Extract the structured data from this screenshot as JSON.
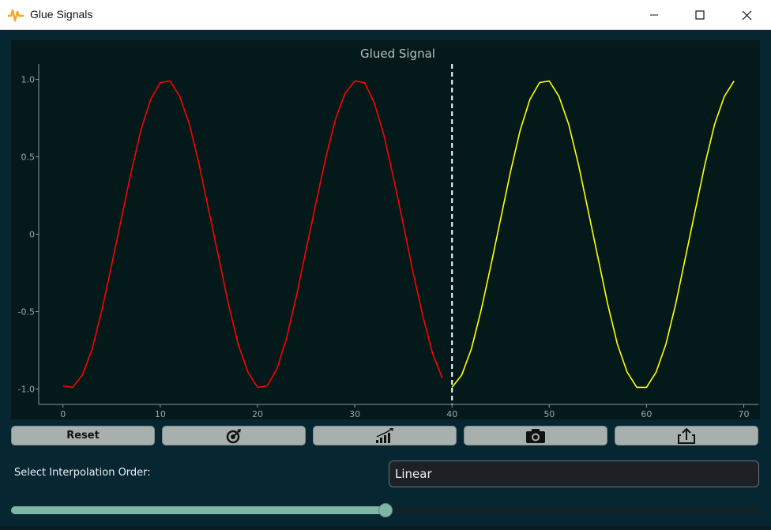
{
  "window": {
    "title": "Glue Signals"
  },
  "toolbar": {
    "reset_label": "Reset",
    "icons": [
      "target-icon",
      "chart-growth-icon",
      "camera-icon",
      "share-icon"
    ]
  },
  "interpolation": {
    "label": "Select Interpolation Order:",
    "selected": "Linear"
  },
  "slider": {
    "value_fraction": 0.5
  },
  "chart_data": {
    "type": "line",
    "title": "Glued Signal",
    "xlabel": "",
    "ylabel": "",
    "xlim": [
      -2.5,
      71.5
    ],
    "ylim": [
      -1.1,
      1.1
    ],
    "xticks": [
      0,
      10,
      20,
      30,
      40,
      50,
      60,
      70
    ],
    "yticks": [
      1.0,
      0.5,
      0,
      -0.5,
      -1.0
    ],
    "ytick_labels": [
      "1.0",
      "0.5",
      "0",
      "-0.5",
      "-1.0"
    ],
    "divider_x": 40,
    "series": [
      {
        "color": "#ff0000",
        "x": [
          0,
          1,
          2,
          3,
          4,
          5,
          6,
          7,
          8,
          9,
          10,
          11,
          12,
          13,
          14,
          15,
          16,
          17,
          18,
          19,
          20,
          21,
          22,
          23,
          24,
          25,
          26,
          27,
          28,
          29,
          30,
          31,
          32,
          33,
          34,
          35,
          36,
          37,
          38,
          39
        ],
        "values": [
          -0.98,
          -0.99,
          -0.91,
          -0.74,
          -0.49,
          -0.2,
          0.1,
          0.4,
          0.67,
          0.87,
          0.98,
          0.99,
          0.89,
          0.71,
          0.45,
          0.15,
          -0.15,
          -0.45,
          -0.71,
          -0.89,
          -0.99,
          -0.98,
          -0.87,
          -0.67,
          -0.4,
          -0.1,
          0.2,
          0.49,
          0.74,
          0.91,
          0.99,
          0.98,
          0.85,
          0.64,
          0.36,
          0.06,
          -0.25,
          -0.53,
          -0.77,
          -0.93
        ]
      },
      {
        "color": "#ffff00",
        "x": [
          40,
          41,
          42,
          43,
          44,
          45,
          46,
          47,
          48,
          49,
          50,
          51,
          52,
          53,
          54,
          55,
          56,
          57,
          58,
          59,
          60,
          61,
          62,
          63,
          64,
          65,
          66,
          67,
          68,
          69
        ],
        "values": [
          -0.99,
          -0.91,
          -0.74,
          -0.49,
          -0.2,
          0.1,
          0.4,
          0.67,
          0.87,
          0.98,
          0.99,
          0.89,
          0.71,
          0.45,
          0.15,
          -0.15,
          -0.45,
          -0.71,
          -0.89,
          -0.99,
          -0.99,
          -0.89,
          -0.71,
          -0.45,
          -0.15,
          0.15,
          0.45,
          0.71,
          0.89,
          0.99
        ]
      }
    ]
  }
}
